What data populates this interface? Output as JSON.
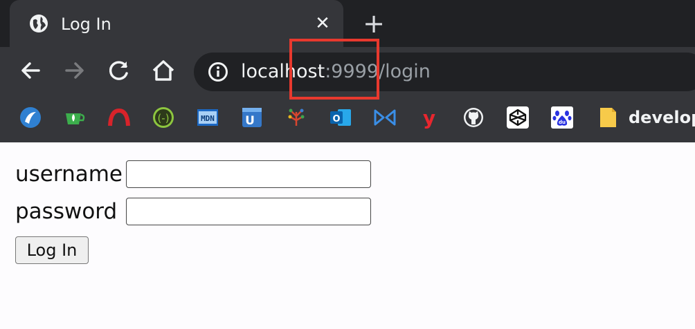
{
  "browser": {
    "tab": {
      "title": "Log In",
      "favicon": "globe-icon",
      "close_glyph": "✕"
    },
    "new_tab_glyph": "+",
    "toolbar": {
      "back": "back-arrow-icon",
      "forward": "forward-arrow-icon",
      "reload": "reload-icon",
      "home": "home-icon"
    },
    "address_bar": {
      "host": "localhost",
      "rest": ":9999/login",
      "icon": "info-icon"
    },
    "highlight_color": "#e8392e",
    "bookmarks": [
      {
        "icon": "blue-circle-bookmark-icon"
      },
      {
        "icon": "green-cup-bookmark-icon"
      },
      {
        "icon": "red-arch-bookmark-icon"
      },
      {
        "icon": "green-parens-bookmark-icon"
      },
      {
        "icon": "mdn-bookmark-icon"
      },
      {
        "icon": "blue-u-bookmark-icon"
      },
      {
        "icon": "colorful-tree-bookmark-icon"
      },
      {
        "icon": "outlook-bookmark-icon"
      },
      {
        "icon": "blue-bowtie-bookmark-icon"
      },
      {
        "icon": "red-y-bookmark-icon"
      },
      {
        "icon": "github-bookmark-icon"
      },
      {
        "icon": "codepen-bookmark-icon"
      },
      {
        "icon": "baidu-paw-bookmark-icon"
      }
    ],
    "bookmark_folder": {
      "icon": "folder-icon",
      "label": "develop"
    }
  },
  "form": {
    "username_label": "username",
    "password_label": "password",
    "username_value": "",
    "password_value": "",
    "submit_label": "Log In"
  }
}
